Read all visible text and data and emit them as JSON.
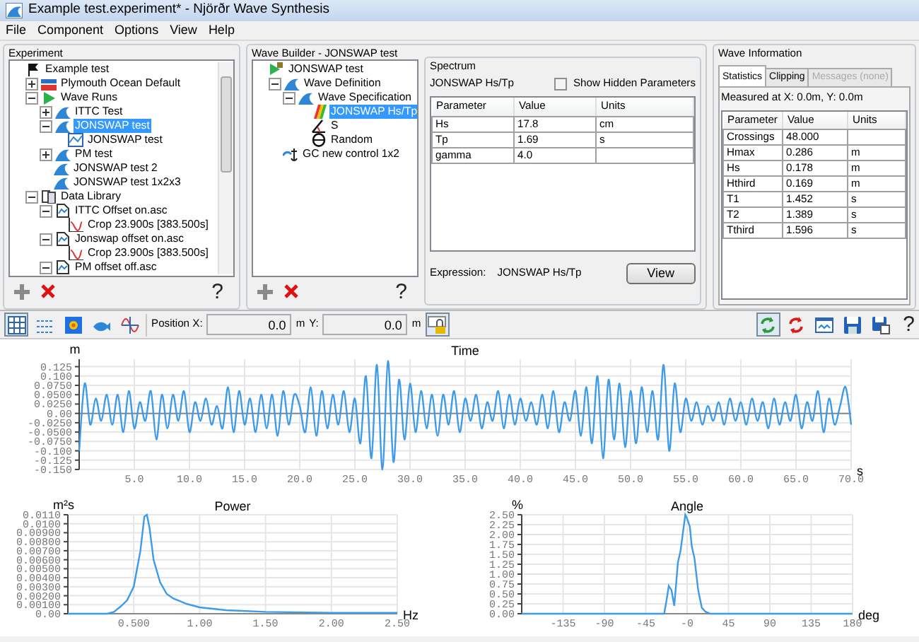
{
  "window": {
    "title": "Example test.experiment* - Njörðr Wave Synthesis"
  },
  "menu": [
    "File",
    "Component",
    "Options",
    "View",
    "Help"
  ],
  "experiment": {
    "title": "Experiment",
    "help": "?",
    "tree": [
      {
        "label": "Example test",
        "kind": "experiment",
        "selected": false,
        "children": [
          {
            "label": "Plymouth Ocean Default",
            "kind": "ocean",
            "expanded": false,
            "selected": false
          },
          {
            "label": "Wave Runs",
            "kind": "runs",
            "expanded": true,
            "selected": false,
            "children": [
              {
                "label": "ITTC Test",
                "kind": "wave",
                "expanded": false,
                "selected": false
              },
              {
                "label": "JONSWAP test",
                "kind": "wave",
                "expanded": true,
                "selected": true,
                "children": [
                  {
                    "label": "JONSWAP test",
                    "kind": "chart",
                    "selected": false
                  }
                ]
              },
              {
                "label": "PM test",
                "kind": "wave",
                "expanded": false,
                "selected": false
              },
              {
                "label": "JONSWAP test 2",
                "kind": "wave",
                "selected": false
              },
              {
                "label": "JONSWAP test 1x2x3",
                "kind": "wave",
                "selected": false
              }
            ]
          },
          {
            "label": "Data Library",
            "kind": "library",
            "expanded": true,
            "selected": false,
            "children": [
              {
                "label": "ITTC Offset on.asc",
                "kind": "file",
                "expanded": true,
                "selected": false,
                "children": [
                  {
                    "label": "Crop 23.900s [383.500s]",
                    "kind": "crop",
                    "selected": false
                  }
                ]
              },
              {
                "label": "Jonswap offset on.asc",
                "kind": "file",
                "expanded": true,
                "selected": false,
                "children": [
                  {
                    "label": "Crop 23.900s [383.500s]",
                    "kind": "crop",
                    "selected": false
                  }
                ]
              },
              {
                "label": "PM offset off.asc",
                "kind": "file",
                "expanded": true,
                "selected": false
              }
            ]
          }
        ]
      }
    ]
  },
  "wave_builder": {
    "title": "Wave Builder - JONSWAP test",
    "help": "?",
    "tree": [
      {
        "label": "JONSWAP test",
        "kind": "runflag",
        "selected": false,
        "children": [
          {
            "label": "Wave Definition",
            "kind": "wave",
            "expanded": true,
            "selected": false,
            "children": [
              {
                "label": "Wave Specification",
                "kind": "wave",
                "expanded": true,
                "selected": false,
                "children": [
                  {
                    "label": "JONSWAP Hs/Tp",
                    "kind": "spectrum",
                    "selected": true
                  },
                  {
                    "label": "S",
                    "kind": "angle",
                    "selected": false
                  },
                  {
                    "label": "Random",
                    "kind": "random",
                    "selected": false
                  }
                ]
              }
            ]
          },
          {
            "label": "GC new control 1x2",
            "kind": "control",
            "selected": false
          }
        ]
      }
    ],
    "spectrum": {
      "title": "Spectrum",
      "name": "JONSWAP Hs/Tp",
      "show_hidden": {
        "label": "Show Hidden Parameters",
        "checked": false
      },
      "columns": [
        "Parameter",
        "Value",
        "Units"
      ],
      "rows": [
        {
          "parameter": "Hs",
          "value": "17.8",
          "units": "cm"
        },
        {
          "parameter": "Tp",
          "value": "1.69",
          "units": "s"
        },
        {
          "parameter": "gamma",
          "value": "4.0"
        }
      ],
      "expression_label": "Expression:",
      "expression": "JONSWAP Hs/Tp",
      "button": "View"
    }
  },
  "wave_information": {
    "title": "Wave Information",
    "tabs": [
      {
        "label": "Statistics",
        "selected": true,
        "disabled": false
      },
      {
        "label": "Clipping",
        "selected": false,
        "disabled": false
      },
      {
        "label": "Messages (none)",
        "selected": false,
        "disabled": true
      }
    ],
    "measured_at": "Measured at X: 0.0m, Y: 0.0m",
    "columns": [
      "Parameter",
      "Value",
      "Units"
    ],
    "rows": [
      {
        "parameter": "Crossings",
        "value": "48.000"
      },
      {
        "parameter": "Hmax",
        "value": "0.286",
        "units": "m"
      },
      {
        "parameter": "Hs",
        "value": "0.178",
        "units": "m"
      },
      {
        "parameter": "Hthird",
        "value": "0.169",
        "units": "m"
      },
      {
        "parameter": "T1",
        "value": "1.452",
        "units": "s"
      },
      {
        "parameter": "T2",
        "value": "1.389",
        "units": "s"
      },
      {
        "parameter": "Tthird",
        "value": "1.596",
        "units": "s"
      }
    ]
  },
  "toolbar": {
    "left": [
      {
        "kind": "grid",
        "pressed": true
      },
      {
        "kind": "lines",
        "pressed": false
      },
      {
        "kind": "heatmap",
        "pressed": false
      },
      {
        "kind": "fish",
        "pressed": false
      },
      {
        "kind": "sine",
        "pressed": false
      }
    ],
    "position_label": "Position X:",
    "x_value": "0.0",
    "x_unit": "m",
    "y_label": "Y:",
    "y_value": "0.0",
    "y_unit": "m",
    "right": [
      {
        "kind": "refresh",
        "pressed": true
      },
      {
        "kind": "refresh_red",
        "pressed": false
      },
      {
        "kind": "window",
        "pressed": false
      },
      {
        "kind": "save",
        "pressed": false
      },
      {
        "kind": "save_as",
        "pressed": false
      }
    ],
    "help": "?"
  },
  "time_chart": {
    "chart_data": {
      "type": "line",
      "grid": true,
      "title": "Time",
      "xlabel": "s",
      "ylabel": "m",
      "xlim": [
        0,
        70
      ],
      "ylim": [
        -0.15,
        0.145
      ],
      "x": [
        0,
        0.5,
        1,
        1.5,
        2,
        2.5,
        3,
        3.5,
        4,
        4.5,
        5,
        5.5,
        6,
        6.5,
        7,
        7.5,
        8,
        8.5,
        9,
        9.5,
        10,
        10.5,
        11,
        11.5,
        12,
        12.5,
        13,
        13.5,
        14,
        14.5,
        15,
        15.5,
        16,
        16.5,
        17,
        17.5,
        18,
        18.5,
        19,
        19.5,
        20,
        20.5,
        21,
        21.5,
        22,
        22.5,
        23,
        23.5,
        24,
        24.5,
        25,
        25.5,
        26,
        26.5,
        27,
        27.5,
        28,
        28.5,
        29,
        29.5,
        30,
        30.5,
        31,
        31.5,
        32,
        32.5,
        33,
        33.5,
        34,
        34.5,
        35,
        35.5,
        36,
        36.5,
        37,
        37.5,
        38,
        38.5,
        39,
        39.5,
        40,
        40.5,
        41,
        41.5,
        42,
        42.5,
        43,
        43.5,
        44,
        44.5,
        45,
        45.5,
        46,
        46.5,
        47,
        47.5,
        48,
        48.5,
        49,
        49.5,
        50,
        50.5,
        51,
        51.5,
        52,
        52.5,
        53,
        53.5,
        54,
        54.5,
        55,
        55.5,
        56,
        56.5,
        57,
        57.5,
        58,
        58.5,
        59,
        59.5,
        60,
        60.5,
        61,
        61.5,
        62,
        62.5,
        63,
        63.5,
        64,
        64.5,
        65,
        65.5,
        66,
        66.5,
        67,
        67.5,
        68,
        68.5,
        69,
        69.5,
        70
      ],
      "xticks": [
        {
          "value": 5,
          "label": "5.0"
        },
        {
          "value": 10,
          "label": "10.0"
        },
        {
          "value": 15,
          "label": "15.0"
        },
        {
          "value": 20,
          "label": "20.0"
        },
        {
          "value": 25,
          "label": "25.0"
        },
        {
          "value": 30,
          "label": "30.0"
        },
        {
          "value": 35,
          "label": "35.0"
        },
        {
          "value": 40,
          "label": "40.0"
        },
        {
          "value": 45,
          "label": "45.0"
        },
        {
          "value": 50,
          "label": "50.0"
        },
        {
          "value": 55,
          "label": "55.0"
        },
        {
          "value": 60,
          "label": "60.0"
        },
        {
          "value": 65,
          "label": "65.0"
        },
        {
          "value": 70,
          "label": "70.0"
        }
      ],
      "yticks": [
        {
          "value": 0.125,
          "label": "0.125"
        },
        {
          "value": 0.1,
          "label": "0.100"
        },
        {
          "value": 0.075,
          "label": "0.0750"
        },
        {
          "value": 0.05,
          "label": "0.0500"
        },
        {
          "value": 0.025,
          "label": "0.0250"
        },
        {
          "value": 0,
          "label": "0.00"
        },
        {
          "value": -0.025,
          "label": "-0.0250"
        },
        {
          "value": -0.05,
          "label": "-0.0500"
        },
        {
          "value": -0.075,
          "label": "-0.0750"
        },
        {
          "value": -0.1,
          "label": "-0.100"
        },
        {
          "value": -0.125,
          "label": "-0.125"
        },
        {
          "value": -0.15,
          "label": "-0.150"
        }
      ],
      "series": [
        {
          "color": "#3d9be9",
          "values": [
            -0.1,
            0.08,
            -0.03,
            0.04,
            -0.02,
            0.05,
            -0.03,
            0.05,
            -0.05,
            0.06,
            -0.04,
            0.03,
            -0.02,
            0.06,
            -0.07,
            0.05,
            -0.04,
            0.05,
            -0.02,
            0.06,
            -0.05,
            0.03,
            -0.02,
            0.04,
            -0.03,
            0.02,
            -0.04,
            0.07,
            -0.05,
            0.06,
            -0.03,
            0.04,
            -0.05,
            0.05,
            -0.04,
            0.05,
            -0.06,
            0.06,
            -0.03,
            0.05,
            0.02,
            -0.05,
            0.07,
            -0.06,
            0.06,
            -0.04,
            0.05,
            -0.03,
            0.06,
            -0.05,
            0.04,
            -0.08,
            0.1,
            -0.12,
            0.13,
            -0.15,
            0.14,
            -0.13,
            0.09,
            -0.07,
            0.08,
            -0.05,
            0.06,
            -0.04,
            0.05,
            -0.06,
            0.05,
            -0.03,
            0.06,
            -0.05,
            0.04,
            -0.02,
            0.05,
            -0.04,
            0.03,
            -0.02,
            0.06,
            -0.04,
            0.05,
            -0.03,
            0.04,
            -0.02,
            0.03,
            -0.03,
            0.05,
            -0.04,
            0.06,
            -0.05,
            0.03,
            -0.02,
            0.06,
            -0.06,
            0.07,
            -0.08,
            0.1,
            -0.12,
            0.09,
            -0.07,
            0.08,
            -0.09,
            0.06,
            -0.08,
            0.07,
            -0.05,
            0.06,
            -0.07,
            0.13,
            -0.1,
            0.08,
            -0.05,
            0.04,
            -0.02,
            0.03,
            -0.03,
            0.02,
            -0.02,
            0.03,
            -0.03,
            0.04,
            -0.02,
            0.03,
            -0.03,
            0.04,
            -0.02,
            0.03,
            -0.04,
            0.04,
            -0.03,
            0.03,
            -0.02,
            0.05,
            -0.04,
            0.03,
            -0.02,
            0.06,
            -0.05,
            0.04,
            -0.03,
            0.02,
            0.07,
            -0.03
          ]
        }
      ]
    }
  },
  "power_chart": {
    "chart_data": {
      "type": "line",
      "grid": true,
      "title": "Power",
      "xlabel": "Hz",
      "ylabel": "m²s",
      "xlim": [
        0,
        2.5
      ],
      "ylim": [
        0,
        0.011
      ],
      "x": [
        0,
        0.3,
        0.35,
        0.4,
        0.45,
        0.5,
        0.55,
        0.58,
        0.6,
        0.62,
        0.65,
        0.7,
        0.75,
        0.8,
        0.9,
        1.0,
        1.2,
        1.5,
        2.0,
        2.5
      ],
      "xticks": [
        {
          "value": 0.5,
          "label": "0.500"
        },
        {
          "value": 1,
          "label": "1.00"
        },
        {
          "value": 1.5,
          "label": "1.50"
        },
        {
          "value": 2,
          "label": "2.00"
        },
        {
          "value": 2.5,
          "label": "2.50"
        }
      ],
      "yticks": [
        {
          "value": 0,
          "label": "0.00"
        },
        {
          "value": 0.001,
          "label": "0.00100"
        },
        {
          "value": 0.002,
          "label": "0.00200"
        },
        {
          "value": 0.003,
          "label": "0.00300"
        },
        {
          "value": 0.004,
          "label": "0.00400"
        },
        {
          "value": 0.005,
          "label": "0.00500"
        },
        {
          "value": 0.006,
          "label": "0.00600"
        },
        {
          "value": 0.007,
          "label": "0.00700"
        },
        {
          "value": 0.008,
          "label": "0.00800"
        },
        {
          "value": 0.009,
          "label": "0.00900"
        },
        {
          "value": 0.01,
          "label": "0.0100"
        },
        {
          "value": 0.011,
          "label": "0.0110"
        }
      ],
      "series": [
        {
          "color": "#3d9be9",
          "values": [
            0,
            0,
            0.0002,
            0.0008,
            0.0015,
            0.003,
            0.007,
            0.0108,
            0.011,
            0.0095,
            0.006,
            0.0035,
            0.0022,
            0.0017,
            0.0011,
            0.0007,
            0.0004,
            0.0002,
            0.0001,
            0.0001
          ]
        }
      ]
    }
  },
  "angle_chart": {
    "chart_data": {
      "type": "line",
      "grid": true,
      "title": "Angle",
      "xlabel": "deg",
      "ylabel": "%",
      "xlim": [
        -180,
        180
      ],
      "ylim": [
        0,
        2.5
      ],
      "x": [
        -180,
        -25,
        -22,
        -20,
        -17,
        -14,
        -10,
        -7,
        -2,
        0,
        3,
        5,
        8,
        12,
        16,
        20,
        25,
        180
      ],
      "xticks": [
        {
          "value": -135,
          "label": "-135"
        },
        {
          "value": -90,
          "label": "-90"
        },
        {
          "value": -45,
          "label": "-45"
        },
        {
          "value": 0,
          "label": "-0"
        },
        {
          "value": 45,
          "label": "45"
        },
        {
          "value": 90,
          "label": "90"
        },
        {
          "value": 135,
          "label": "135"
        },
        {
          "value": 180,
          "label": "180"
        }
      ],
      "yticks": [
        {
          "value": 0,
          "label": "0.00"
        },
        {
          "value": 0.25,
          "label": "0.25"
        },
        {
          "value": 0.5,
          "label": "0.50"
        },
        {
          "value": 0.75,
          "label": "0.75"
        },
        {
          "value": 1,
          "label": "1.00"
        },
        {
          "value": 1.25,
          "label": "1.25"
        },
        {
          "value": 1.5,
          "label": "1.50"
        },
        {
          "value": 1.75,
          "label": "1.75"
        },
        {
          "value": 2,
          "label": "2.00"
        },
        {
          "value": 2.25,
          "label": "2.25"
        },
        {
          "value": 2.5,
          "label": "2.50"
        }
      ],
      "series": [
        {
          "color": "#3d9be9",
          "values": [
            0,
            0,
            0.4,
            0.7,
            0.6,
            0.2,
            1.3,
            1.6,
            2.5,
            2.4,
            2.2,
            1.7,
            1.4,
            0.6,
            0.15,
            0.05,
            0,
            0
          ]
        }
      ]
    }
  }
}
